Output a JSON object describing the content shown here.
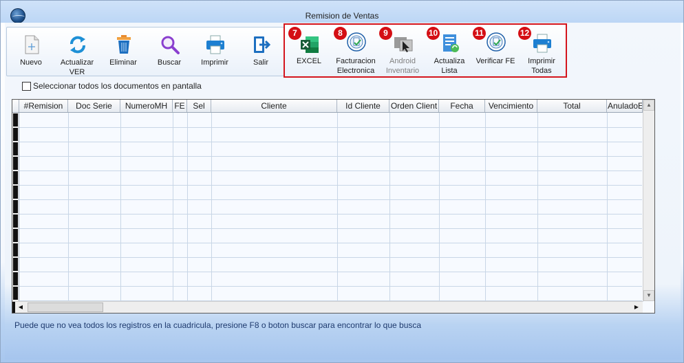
{
  "window": {
    "title": "Remision de Ventas"
  },
  "toolbar_left": [
    {
      "label": "Nuevo",
      "icon": "new-document-icon"
    },
    {
      "label": "Actualizar VER",
      "icon": "refresh-icon"
    },
    {
      "label": "Eliminar",
      "icon": "trash-icon"
    },
    {
      "label": "Buscar",
      "icon": "search-icon"
    },
    {
      "label": "Imprimir",
      "icon": "printer-icon"
    },
    {
      "label": "Salir",
      "icon": "exit-icon"
    }
  ],
  "toolbar_right": [
    {
      "badge": "7",
      "label": "EXCEL",
      "icon": "excel-icon",
      "enabled": true
    },
    {
      "badge": "8",
      "label": "Facturacion Electronica",
      "icon": "e-invoice-seal-icon",
      "enabled": true
    },
    {
      "badge": "9",
      "label": "Android Inventario",
      "icon": "android-inventory-icon",
      "enabled": false
    },
    {
      "badge": "10",
      "label": "Actualiza Lista",
      "icon": "update-list-icon",
      "enabled": true
    },
    {
      "badge": "11",
      "label": "Verificar FE",
      "icon": "verify-fe-seal-icon",
      "enabled": true
    },
    {
      "badge": "12",
      "label": "Imprimir Todas",
      "icon": "print-all-icon",
      "enabled": true
    }
  ],
  "select_all": {
    "label": "Seleccionar todos los documentos en pantalla",
    "checked": false
  },
  "grid": {
    "columns": [
      "#Remision",
      "Doc Serie",
      "NumeroMH",
      "FE",
      "Sel",
      "Cliente",
      "Id Cliente",
      "Orden Client",
      "Fecha",
      "Vencimiento",
      "Total",
      "AnuladoE"
    ],
    "rows": []
  },
  "status_message": "Puede que no vea todos los registros en la cuadricula, presione F8 o boton buscar para encontrar lo que busca",
  "colors": {
    "badge": "#d40e14",
    "highlight_border": "#d4141c",
    "accent": "#1f6fd1"
  }
}
